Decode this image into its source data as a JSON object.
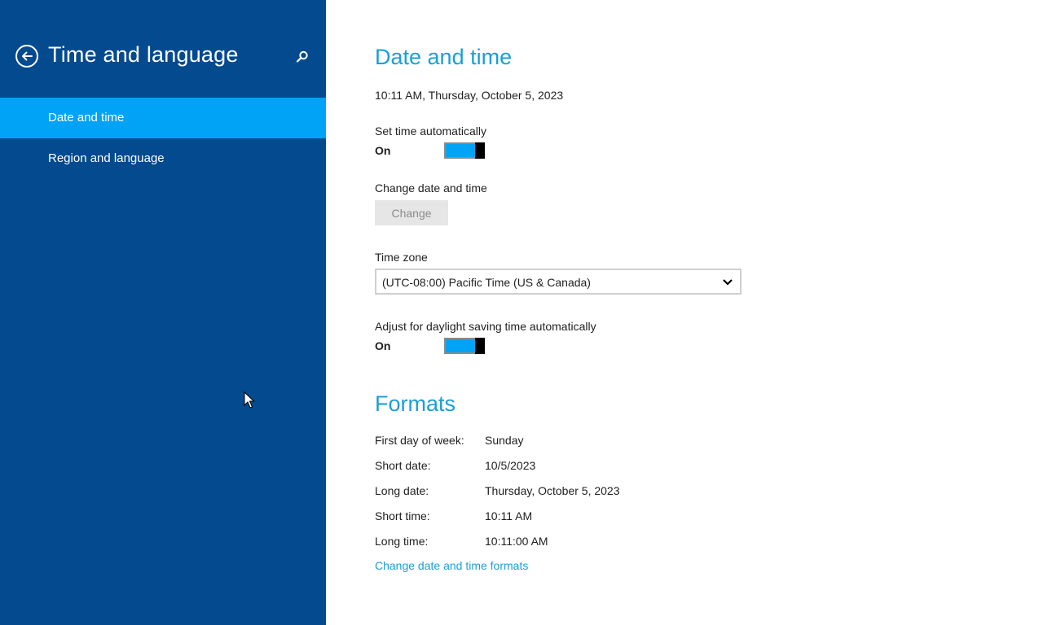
{
  "sidebar": {
    "title": "Time and language",
    "items": [
      {
        "label": "Date and time"
      },
      {
        "label": "Region and language"
      }
    ]
  },
  "main": {
    "date_time": {
      "title": "Date and time",
      "current": "10:11 AM, Thursday, October 5, 2023",
      "set_auto_label": "Set time automatically",
      "set_auto_state": "On",
      "change_label": "Change date and time",
      "change_button": "Change",
      "timezone_label": "Time zone",
      "timezone_value": "(UTC-08:00) Pacific Time (US & Canada)",
      "dst_label": "Adjust for daylight saving time automatically",
      "dst_state": "On"
    },
    "formats": {
      "title": "Formats",
      "rows": [
        {
          "label": "First day of week:",
          "value": "Sunday"
        },
        {
          "label": "Short date:",
          "value": "10/5/2023"
        },
        {
          "label": "Long date:",
          "value": "Thursday, October 5, 2023"
        },
        {
          "label": "Short time:",
          "value": "10:11 AM"
        },
        {
          "label": "Long time:",
          "value": "10:11:00 AM"
        }
      ],
      "link": "Change date and time formats"
    }
  },
  "colors": {
    "sidebar_bg": "#034a8f",
    "nav_active": "#00a3f5",
    "accent": "#1a9fd6",
    "toggle_on": "#00a3f5"
  },
  "icons": [
    "back-arrow-icon",
    "search-icon",
    "chevron-down-icon",
    "mouse-cursor-icon"
  ]
}
